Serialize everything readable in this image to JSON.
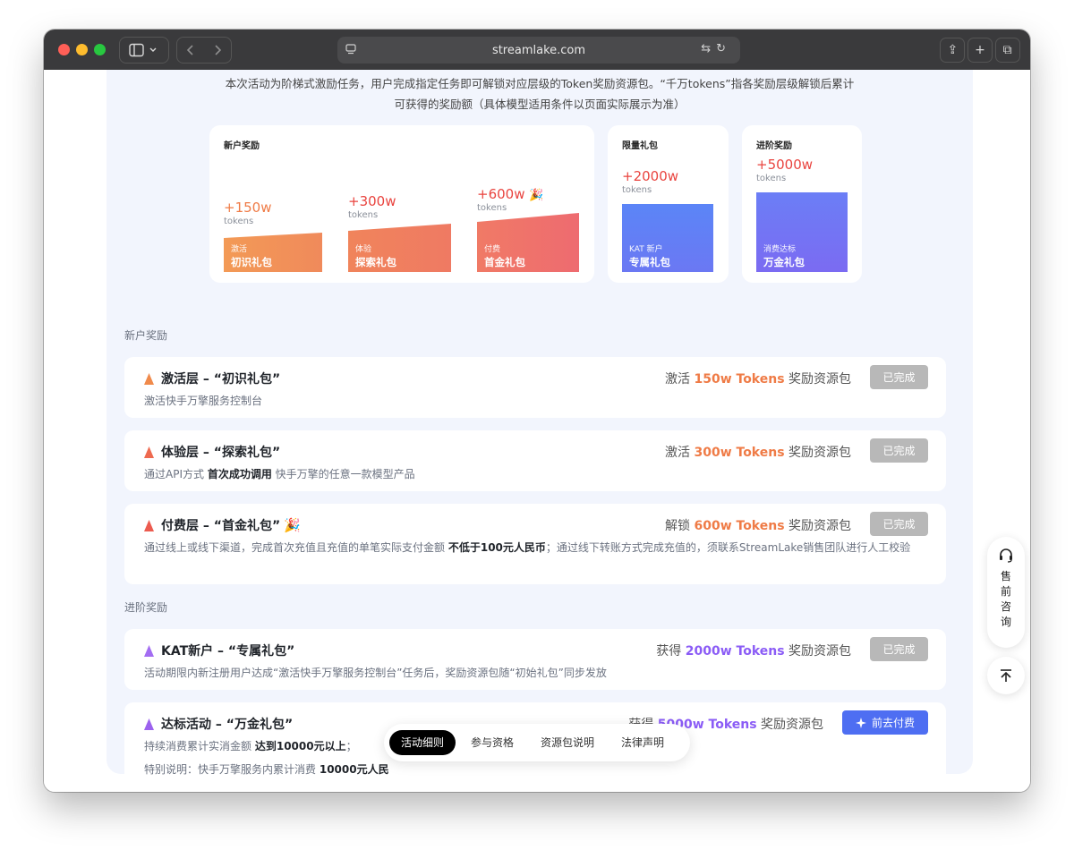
{
  "browser": {
    "url": "streamlake.com"
  },
  "intro": {
    "line1": "本次活动为阶梯式激励任务，用户完成指定任务即可解锁对应层级的Token奖励资源包。“千万tokens”指各奖励层级解锁后累计",
    "line2": "可获得的奖励额（具体模型适用条件以页面实际展示为准）"
  },
  "summary_cards": {
    "newbie": {
      "title": "新户奖励",
      "items": [
        {
          "amount": "+150w",
          "unit": "tokens",
          "tag": "激活",
          "name": "初识礼包"
        },
        {
          "amount": "+300w",
          "unit": "tokens",
          "tag": "体验",
          "name": "探索礼包"
        },
        {
          "amount": "+600w",
          "unit": "tokens",
          "tag": "付费",
          "name": "首金礼包"
        }
      ]
    },
    "limited": {
      "title": "限量礼包",
      "amount": "+2000w",
      "unit": "tokens",
      "tag": "KAT 新户",
      "name": "专属礼包"
    },
    "advanced": {
      "title": "进阶奖励",
      "amount": "+5000w",
      "unit": "tokens",
      "tag": "消费达标",
      "name": "万金礼包"
    }
  },
  "sections": {
    "newbie_title": "新户奖励",
    "advanced_title": "进阶奖励"
  },
  "tasks": [
    {
      "title": "激活层 – “初识礼包”",
      "desc": "激活快手万擎服务控制台",
      "reward_prefix": "激活",
      "reward_value": "150w Tokens",
      "reward_suffix": "奖励资源包",
      "status": "已完成"
    },
    {
      "title": "体验层 – “探索礼包”",
      "desc_parts": [
        "通过API方式",
        "首次成功调用",
        "快手万擎的任意一款模型产品"
      ],
      "reward_prefix": "激活",
      "reward_value": "300w Tokens",
      "reward_suffix": "奖励资源包",
      "status": "已完成"
    },
    {
      "title": "付费层 – “首金礼包”",
      "desc_parts": [
        "通过线上或线下渠道，完成首次充值且充值的单笔实际支付金额",
        "不低于100元人民币",
        "；通过线下转账方式完成充值的，须联系StreamLake销售团队进行人工",
        "校验"
      ],
      "reward_prefix": "解锁",
      "reward_value": "600w Tokens",
      "reward_suffix": "奖励资源包",
      "status": "已完成"
    },
    {
      "title": "KAT新户 – “专属礼包”",
      "desc": "活动期限内新注册用户达成“激活快手万擎服务控制台”任务后，奖励资源包随“初始礼包”同步发放",
      "reward_prefix": "获得",
      "reward_value": "2000w Tokens",
      "reward_suffix": "奖励资源包",
      "status": "已完成"
    },
    {
      "title": "达标活动 – “万金礼包”",
      "desc_parts": [
        "持续消费累计实消金额",
        "达到10000元以上",
        "；"
      ],
      "desc2_parts": [
        "特别说明：快手万擎服务内累计消费",
        "10000元人民"
      ],
      "reward_prefix": "获得",
      "reward_value": "5000w Tokens",
      "reward_suffix": "奖励资源包",
      "action": "前去付费"
    }
  ],
  "float": {
    "consult": "售前咨询"
  },
  "bottom_tabs": [
    "活动细则",
    "参与资格",
    "资源包说明",
    "法律声明"
  ],
  "colors": {
    "orange": "#ef7b46",
    "red": "#e9443f",
    "purple": "#8b5cf6",
    "blue_button": "#4e6ef2",
    "done_button": "#b8b8b8"
  }
}
